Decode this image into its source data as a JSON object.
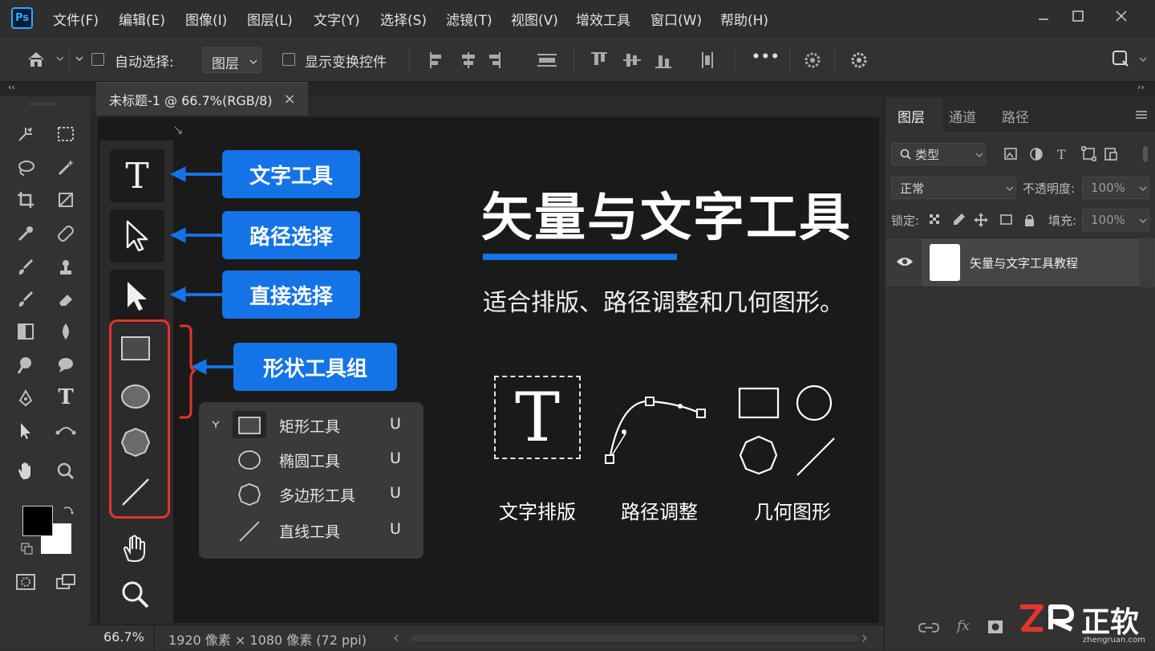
{
  "app": {
    "logo": "Ps"
  },
  "menu": [
    "文件(F)",
    "编辑(E)",
    "图像(I)",
    "图层(L)",
    "文字(Y)",
    "选择(S)",
    "滤镜(T)",
    "视图(V)",
    "增效工具",
    "窗口(W)",
    "帮助(H)"
  ],
  "options": {
    "auto_select_label": "自动选择:",
    "layer_dropdown": "图层",
    "show_transform_label": "显示变换控件",
    "more_label": "•••"
  },
  "document_tab": {
    "title": "未标题-1 @ 66.7%(RGB/8)",
    "close": "×"
  },
  "left_toolbar": {
    "collapse_glyph": "‹‹",
    "type_glyph": "T"
  },
  "tool_column": {
    "type_glyph": "T"
  },
  "callouts": {
    "text_tool": "文字工具",
    "path_select": "路径选择",
    "direct_select": "直接选择",
    "shape_group": "形状工具组"
  },
  "flyout": [
    {
      "label": "矩形工具",
      "key": "U",
      "icon": "rectangle-icon"
    },
    {
      "label": "椭圆工具",
      "key": "U",
      "icon": "ellipse-icon"
    },
    {
      "label": "多边形工具",
      "key": "U",
      "icon": "polygon-icon"
    },
    {
      "label": "直线工具",
      "key": "U",
      "icon": "line-icon"
    }
  ],
  "slide": {
    "title": "矢量与文字工具",
    "subtitle": "适合排版、路径调整和几何图形。",
    "icon_glyph": "T",
    "features": [
      "文字排版",
      "路径调整",
      "几何图形"
    ],
    "accent": "#1473e6"
  },
  "status": {
    "zoom": "66.7%",
    "doc_info": "1920 像素 × 1080 像素 (72 ppi)",
    "nav_left": "‹",
    "nav_right": "›"
  },
  "layers_panel": {
    "tabs": [
      "图层",
      "通道",
      "路径"
    ],
    "filter_label": "类型",
    "blend_mode": "正常",
    "opacity_label": "不透明度:",
    "opacity_value": "100%",
    "lock_label": "锁定:",
    "fill_label": "填充:",
    "fill_value": "100%",
    "filter_type_glyph": "T",
    "layers": [
      {
        "name": "矢量与文字工具教程",
        "visible": true
      }
    ],
    "fx_label": "fx"
  },
  "watermark": {
    "brand": "正软",
    "url": "zhengruan.com"
  }
}
